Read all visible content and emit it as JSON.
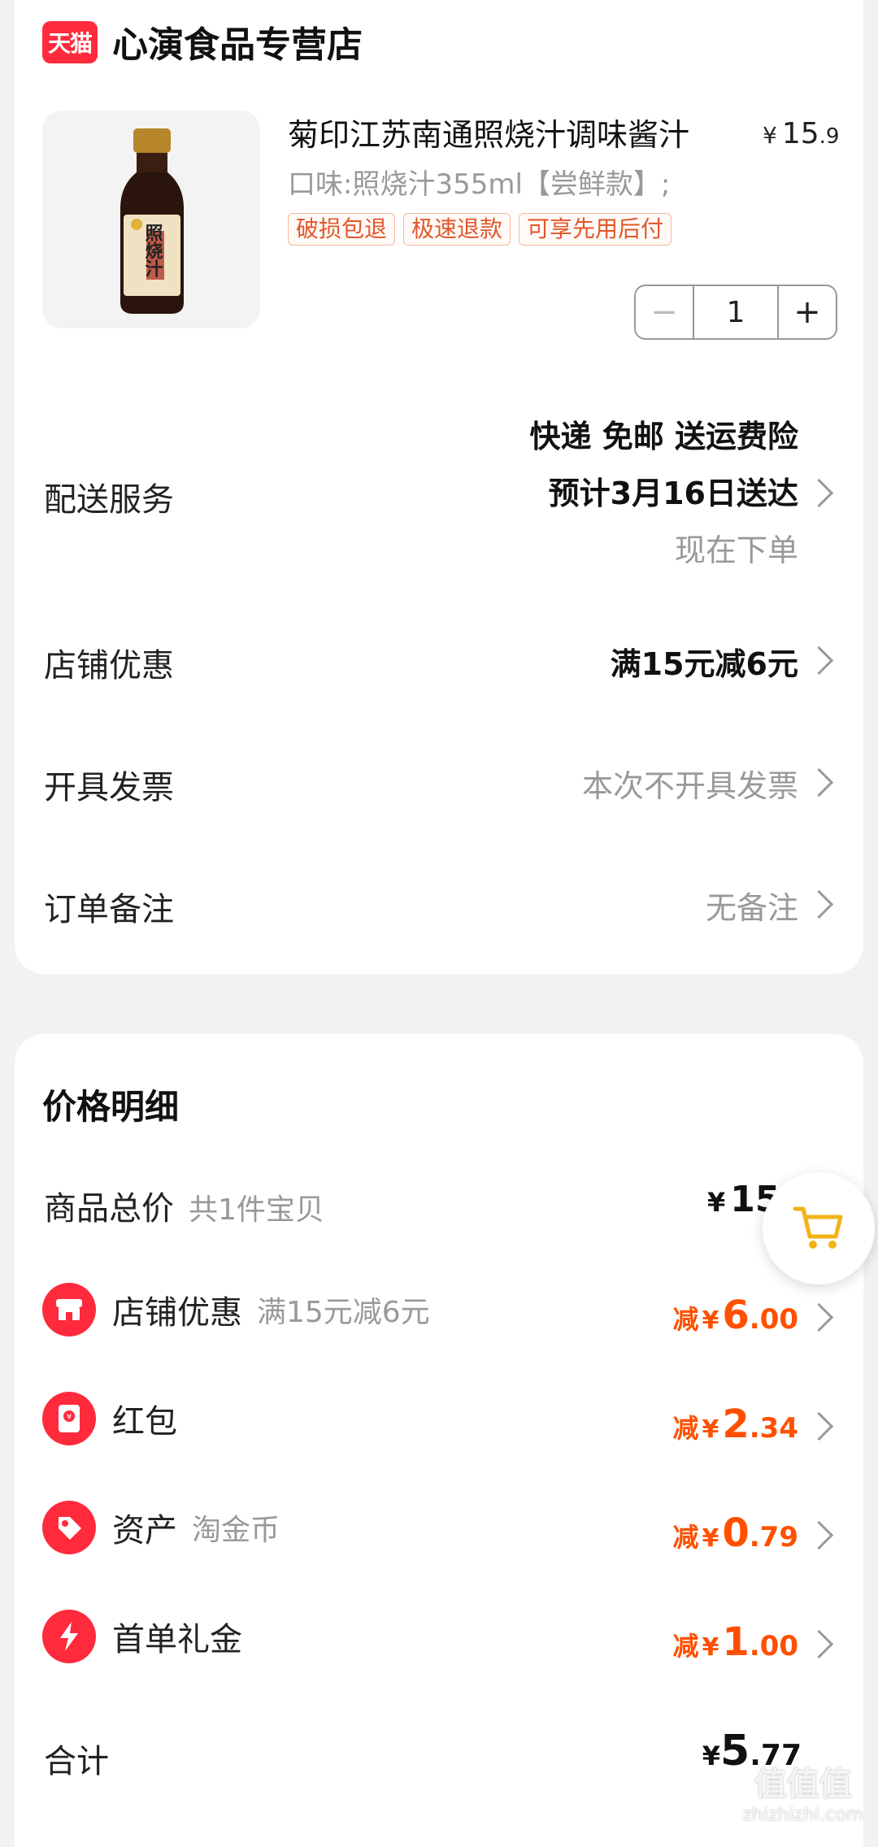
{
  "store": {
    "badge": "天猫",
    "name": "心演食品专营店"
  },
  "product": {
    "title": "菊印江苏南通照烧汁调味酱汁",
    "price_symbol": "¥",
    "price_int": "15",
    "price_dec": ".9",
    "variant": "口味:照烧汁355ml【尝鲜款】;",
    "tags": [
      "破损包退",
      "极速退款",
      "可享先用后付"
    ],
    "quantity": "1",
    "minus": "−",
    "plus": "+",
    "label_text": "照烧汁"
  },
  "delivery": {
    "label": "配送服务",
    "line1": "快递 免邮 送运费险",
    "line2": "预计3月16日送达",
    "line3": "现在下单"
  },
  "store_discount": {
    "label": "店铺优惠",
    "value": "满15元减6元"
  },
  "invoice": {
    "label": "开具发票",
    "value": "本次不开具发票"
  },
  "note": {
    "label": "订单备注",
    "value": "无备注"
  },
  "price_detail": {
    "title": "价格明细",
    "total_goods": {
      "label": "商品总价",
      "sub": "共1件宝贝",
      "yen": "¥",
      "value": "15"
    },
    "items": [
      {
        "label": "店铺优惠",
        "sub": "满15元减6元",
        "pre": "减",
        "yen": "¥",
        "int": "6",
        "dec": ".00",
        "icon": "shop-icon"
      },
      {
        "label": "红包",
        "sub": "",
        "pre": "减",
        "yen": "¥",
        "int": "2",
        "dec": ".34",
        "icon": "red-packet-icon"
      },
      {
        "label": "资产",
        "sub": "淘金币",
        "pre": "减",
        "yen": "¥",
        "int": "0",
        "dec": ".79",
        "icon": "coin-tag-icon"
      },
      {
        "label": "首单礼金",
        "sub": "",
        "pre": "减",
        "yen": "¥",
        "int": "1",
        "dec": ".00",
        "icon": "lightning-icon"
      }
    ],
    "total": {
      "label": "合计",
      "yen": "¥",
      "int": "5",
      "dec": ".77"
    }
  },
  "watermark": {
    "line1": "值值值",
    "line2": "zhizhizhi.com"
  },
  "colors": {
    "accent": "#ff2a3c",
    "discount": "#ff5000",
    "tag_border": "#f6b79a"
  }
}
